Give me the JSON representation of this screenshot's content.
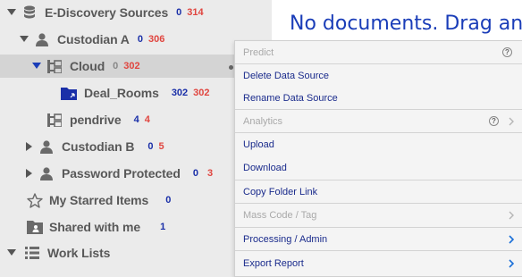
{
  "tree": {
    "items": [
      {
        "label": "E-Discovery Sources",
        "blue": "0",
        "red": "314"
      },
      {
        "label": "Custodian A",
        "blue": "0",
        "red": "306"
      },
      {
        "label": "Cloud",
        "blue": "0",
        "red": "302"
      },
      {
        "label": "Deal_Rooms",
        "blue": "302",
        "red": "302"
      },
      {
        "label": "pendrive",
        "blue": "4",
        "red": "4"
      },
      {
        "label": "Custodian B",
        "blue": "0",
        "red": "5"
      },
      {
        "label": "Password Protected",
        "blue": "0",
        "red": "3"
      },
      {
        "label": "My Starred Items",
        "blue": "0"
      },
      {
        "label": "Shared with me",
        "blue": "1"
      },
      {
        "label": "Work Lists"
      }
    ]
  },
  "main": {
    "message": "No documents. Drag and"
  },
  "context_menu": {
    "items": [
      {
        "label": "Predict"
      },
      {
        "label": "Delete Data Source"
      },
      {
        "label": "Rename Data Source"
      },
      {
        "label": "Analytics"
      },
      {
        "label": "Upload"
      },
      {
        "label": "Download"
      },
      {
        "label": "Copy Folder Link"
      },
      {
        "label": "Mass Code / Tag"
      },
      {
        "label": "Processing / Admin"
      },
      {
        "label": "Export Report"
      }
    ]
  },
  "colors": {
    "count_blue": "#1a2fa8",
    "count_red": "#e0453f",
    "menu_text": "#1a2b8c",
    "menu_disabled": "#a9a9a9",
    "main_message": "#1a3db8"
  }
}
